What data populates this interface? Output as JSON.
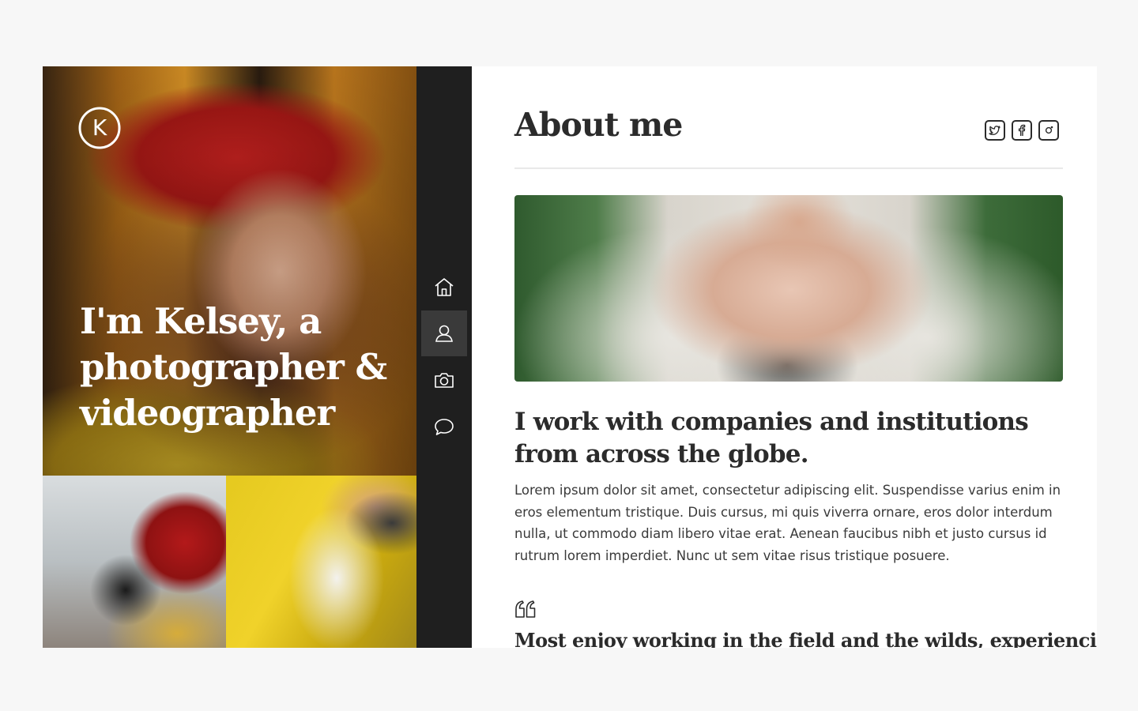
{
  "hero": {
    "logo_letter": "K",
    "title": "I'm Kelsey, a photographer & videographer"
  },
  "rail": {
    "items": [
      {
        "icon": "home-icon",
        "active": false
      },
      {
        "icon": "user-icon",
        "active": true
      },
      {
        "icon": "camera-icon",
        "active": false
      },
      {
        "icon": "chat-icon",
        "active": false
      }
    ]
  },
  "about": {
    "title": "About me",
    "socials": [
      "twitter-icon",
      "facebook-icon",
      "instagram-icon"
    ],
    "heading": "I work with companies and institutions from across the globe.",
    "body": "Lorem ipsum dolor sit amet, consectetur adipiscing elit. Suspendisse varius enim in eros elementum tristique. Duis cursus, mi quis viverra ornare, eros dolor interdum nulla, ut commodo diam libero vitae erat. Aenean faucibus nibh et justo cursus id rutrum lorem imperdiet. Nunc ut sem vitae risus tristique posuere.",
    "quote": "Most enjoy working in the field and the wilds, experiencing"
  },
  "colors": {
    "page_bg": "#f7f7f7",
    "rail_bg": "#1f1f1f",
    "rail_active": "#3a3a3a",
    "text": "#2b2b2b"
  }
}
